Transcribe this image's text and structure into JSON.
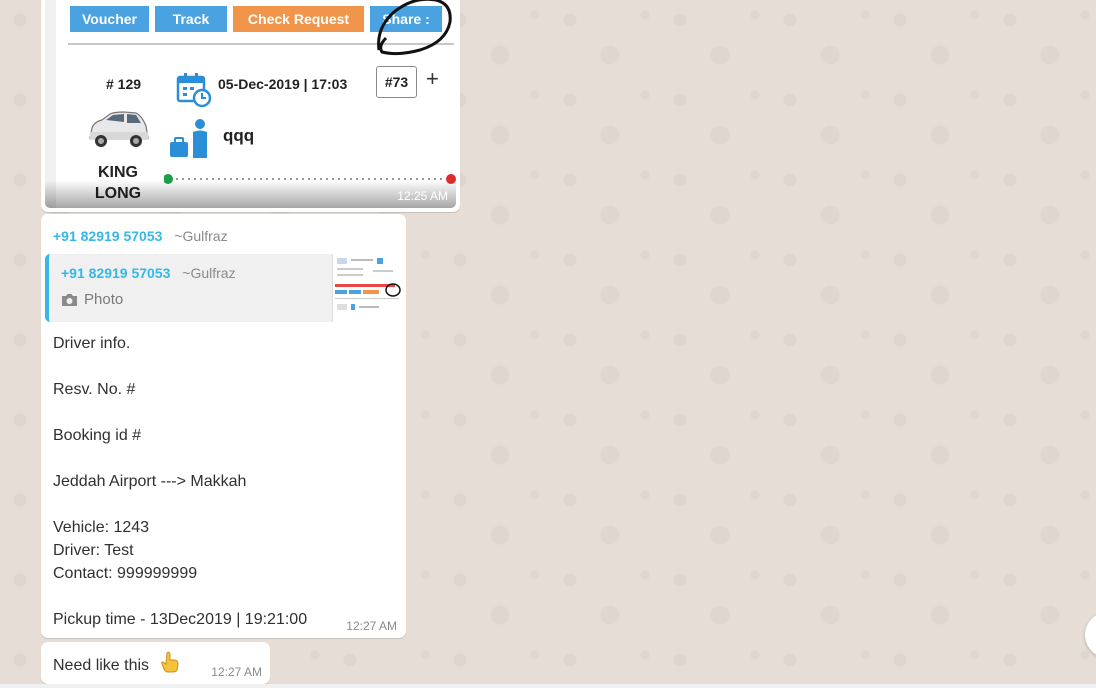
{
  "image_message": {
    "buttons": {
      "voucher": "Voucher",
      "track": "Track",
      "check_request": "Check Request",
      "share": "Share :"
    },
    "card": {
      "resv_number": "# 129",
      "datetime": "05-Dec-2019 | 17:03",
      "count_badge": "#73",
      "plus": "+",
      "passenger_name": "qqq",
      "car_label": "KING LONG"
    },
    "time": "12:25 AM"
  },
  "text_message": {
    "sender_phone": "+91 82919 57053",
    "sender_alias": "~Gulfraz",
    "quoted": {
      "phone": "+91 82919 57053",
      "alias": "~Gulfraz",
      "media_label": "Photo"
    },
    "body": "Driver info.\n\nResv. No. #\n\nBooking id #\n\nJeddah Airport  --->  Makkah\n\nVehicle: 1243\nDriver: Test\nContact: 999999999\n\nPickup time - 13Dec2019 | 19:21:00",
    "time": "12:27 AM"
  },
  "small_message": {
    "text": "Need like this",
    "time": "12:27 AM"
  },
  "colors": {
    "wallpaper": "#e6ded6",
    "bubble": "#ffffff",
    "link_blue": "#35b7e8",
    "button_blue": "#4aa3e0",
    "button_orange": "#f0954a"
  }
}
